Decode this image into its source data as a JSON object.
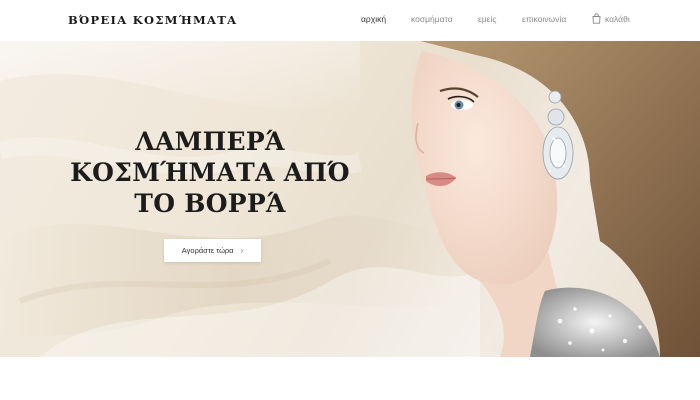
{
  "header": {
    "logo": "ΒΌΡΕΙΑ ΚΟΣΜΉΜΑΤΑ",
    "nav": {
      "home": "αρχική",
      "jewelry": "κοσμήματα",
      "about": "εμείς",
      "contact": "επικοινωνία",
      "cart": "καλάθι"
    },
    "cart_icon": "shopping-bag-icon"
  },
  "hero": {
    "title_lines": [
      "ΛΑΜΠΕΡΆ",
      "ΚΟΣΜΉΜΑΤΑ ΑΠΌ",
      "ΤΟ ΒΟΡΡΆ"
    ],
    "cta_label": "Αγοράστε τώρα",
    "cta_icon": "chevron-right-icon",
    "image": "model-with-diamond-earring"
  },
  "colors": {
    "background": "#ffffff",
    "hero_cream": "#efe6d7",
    "text_dark": "#1c1c1c",
    "nav_inactive": "#8a8a8a"
  }
}
